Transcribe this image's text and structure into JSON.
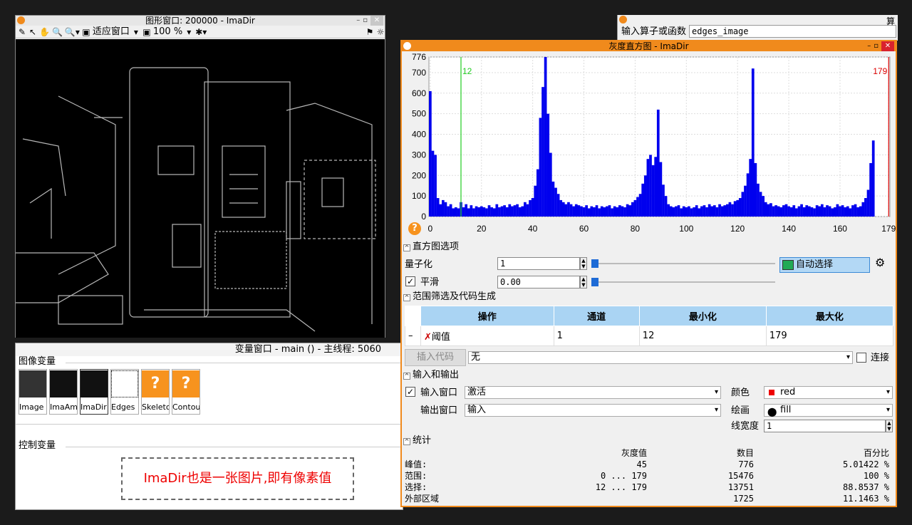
{
  "graphics_window": {
    "title": "图形窗口: 200000 - ImaDir",
    "fit_label": "适应窗口",
    "zoom_label": "100 %"
  },
  "variable_window": {
    "title": "变量窗口 - main () - 主线程: 5060",
    "image_vars_label": "图像变量",
    "control_vars_label": "控制变量",
    "thumbs": [
      {
        "label": "Image",
        "kind": "img"
      },
      {
        "label": "ImaAm",
        "kind": "img"
      },
      {
        "label": "ImaDir",
        "kind": "img"
      },
      {
        "label": "Edges",
        "kind": "img"
      },
      {
        "label": "Skeleton",
        "kind": "q"
      },
      {
        "label": "Contours",
        "kind": "q"
      }
    ],
    "note": "ImaDir也是一张图片,即有像素值"
  },
  "algo_bar": {
    "title_right": "算",
    "input_label": "输入算子或函数",
    "input_value": "edges_image"
  },
  "histogram_window": {
    "title": "灰度直方图 - ImaDir",
    "chart_data": {
      "type": "bar",
      "title": "",
      "xlabel": "",
      "ylabel": "",
      "x": [
        0,
        1,
        2,
        3,
        4,
        5,
        6,
        7,
        8,
        9,
        10,
        11,
        12,
        13,
        14,
        15,
        16,
        17,
        18,
        19,
        20,
        21,
        22,
        23,
        24,
        25,
        26,
        27,
        28,
        29,
        30,
        31,
        32,
        33,
        34,
        35,
        36,
        37,
        38,
        39,
        40,
        41,
        42,
        43,
        44,
        45,
        46,
        47,
        48,
        49,
        50,
        51,
        52,
        53,
        54,
        55,
        56,
        57,
        58,
        59,
        60,
        61,
        62,
        63,
        64,
        65,
        66,
        67,
        68,
        69,
        70,
        71,
        72,
        73,
        74,
        75,
        76,
        77,
        78,
        79,
        80,
        81,
        82,
        83,
        84,
        85,
        86,
        87,
        88,
        89,
        90,
        91,
        92,
        93,
        94,
        95,
        96,
        97,
        98,
        99,
        100,
        101,
        102,
        103,
        104,
        105,
        106,
        107,
        108,
        109,
        110,
        111,
        112,
        113,
        114,
        115,
        116,
        117,
        118,
        119,
        120,
        121,
        122,
        123,
        124,
        125,
        126,
        127,
        128,
        129,
        130,
        131,
        132,
        133,
        134,
        135,
        136,
        137,
        138,
        139,
        140,
        141,
        142,
        143,
        144,
        145,
        146,
        147,
        148,
        149,
        150,
        151,
        152,
        153,
        154,
        155,
        156,
        157,
        158,
        159,
        160,
        161,
        162,
        163,
        164,
        165,
        166,
        167,
        168,
        169,
        170,
        171,
        172,
        173,
        174,
        175,
        176,
        177,
        178,
        179
      ],
      "values": [
        610,
        320,
        300,
        90,
        60,
        80,
        70,
        50,
        60,
        40,
        45,
        40,
        70,
        45,
        60,
        40,
        55,
        40,
        50,
        45,
        50,
        45,
        40,
        55,
        45,
        40,
        60,
        45,
        50,
        55,
        45,
        60,
        50,
        55,
        60,
        45,
        50,
        70,
        60,
        80,
        90,
        150,
        230,
        480,
        630,
        776,
        500,
        310,
        170,
        140,
        110,
        80,
        70,
        60,
        70,
        60,
        50,
        60,
        55,
        50,
        45,
        55,
        40,
        50,
        45,
        55,
        40,
        50,
        45,
        50,
        55,
        40,
        50,
        45,
        55,
        50,
        45,
        60,
        55,
        70,
        80,
        95,
        110,
        160,
        200,
        280,
        300,
        250,
        290,
        520,
        265,
        155,
        100,
        60,
        50,
        45,
        50,
        55,
        40,
        50,
        45,
        50,
        40,
        45,
        55,
        40,
        50,
        55,
        45,
        60,
        50,
        55,
        45,
        60,
        50,
        55,
        60,
        70,
        60,
        75,
        80,
        90,
        120,
        150,
        210,
        280,
        720,
        260,
        160,
        120,
        100,
        70,
        60,
        65,
        50,
        55,
        50,
        45,
        55,
        60,
        50,
        45,
        55,
        40,
        50,
        60,
        45,
        55,
        50,
        45,
        40,
        55,
        50,
        60,
        45,
        55,
        50,
        40,
        45,
        60,
        50,
        55,
        45,
        50,
        40,
        55,
        60,
        45,
        50,
        70,
        90,
        130,
        260,
        370
      ],
      "xlim": [
        0,
        179
      ],
      "ylim": [
        0,
        776
      ],
      "x_ticks": [
        "0",
        "20",
        "40",
        "60",
        "80",
        "100",
        "120",
        "140",
        "160",
        "179"
      ],
      "y_ticks": [
        "0",
        "100",
        "200",
        "300",
        "400",
        "500",
        "600",
        "700",
        "776"
      ],
      "thresholds": [
        {
          "value": 12,
          "label": "12",
          "color": "#22cc22"
        },
        {
          "value": 179,
          "label": "179",
          "color": "#dd0000"
        }
      ],
      "bar_color": "#0000ee"
    },
    "options_section": "直方图选项",
    "quantize_label": "量子化",
    "quantize_value": "1",
    "smooth_label": "平滑",
    "smooth_value": "0.00",
    "auto_select_label": "自动选择",
    "range_section": "范围筛选及代码生成",
    "table": {
      "headers": [
        "操作",
        "通道",
        "最小化",
        "最大化"
      ],
      "row": {
        "op": "阈值",
        "channel": "1",
        "min": "12",
        "max": "179"
      }
    },
    "insert_code_label": "插入代码",
    "insert_code_combo": "无",
    "connect_label": "连接",
    "io_section": "输入和输出",
    "input_window_label": "输入窗口",
    "input_window_value": "激活",
    "output_window_label": "输出窗口",
    "output_window_value": "输入",
    "color_label": "颜色",
    "color_value": "red",
    "draw_label": "绘画",
    "draw_value": "fill",
    "linewidth_label": "线宽度",
    "linewidth_value": "1",
    "stats_section": "统计",
    "stats": {
      "headers": [
        "",
        "灰度值",
        "数目",
        "百分比"
      ],
      "rows": [
        [
          "峰值:",
          "45",
          "776",
          "5.01422 %"
        ],
        [
          "范围:",
          "0 ... 179",
          "15476",
          "100 %"
        ],
        [
          "选择:",
          "12 ... 179",
          "13751",
          "88.8537 %"
        ],
        [
          "外部区域",
          "",
          "1725",
          "11.1463 %"
        ]
      ]
    }
  }
}
